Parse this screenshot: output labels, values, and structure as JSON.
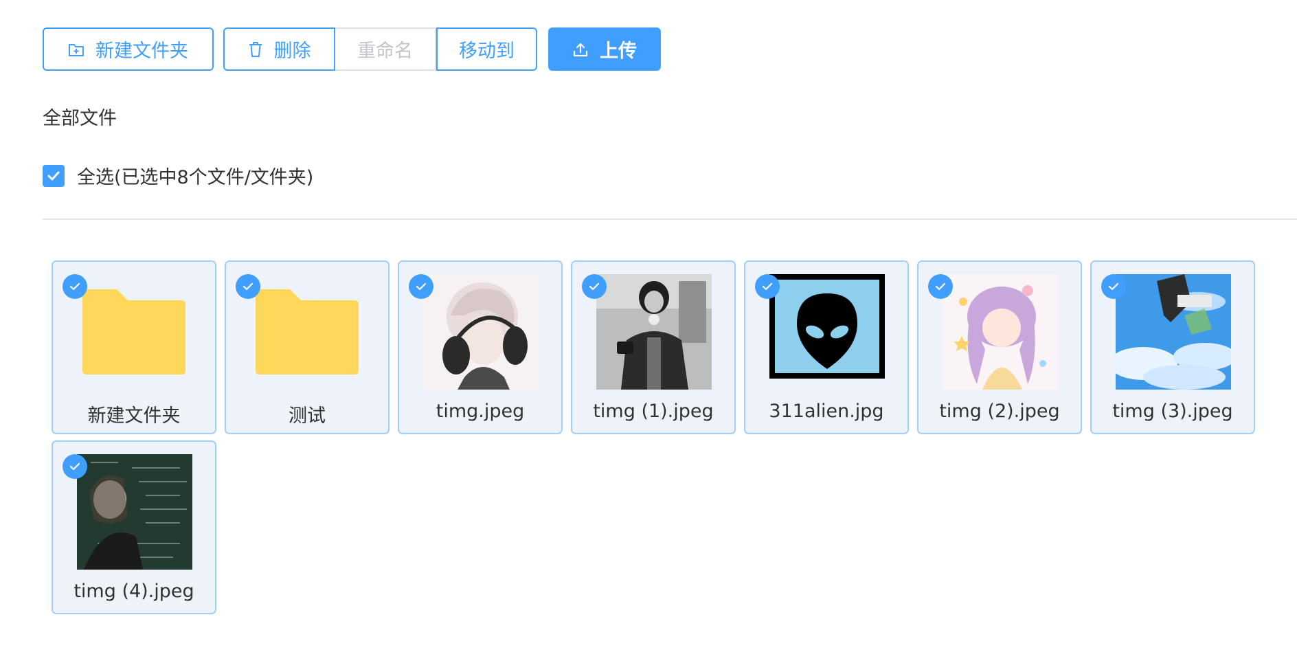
{
  "toolbar": {
    "new_folder_label": "新建文件夹",
    "delete_label": "删除",
    "rename_label": "重命名",
    "move_label": "移动到",
    "upload_label": "上传"
  },
  "breadcrumb": {
    "current": "全部文件"
  },
  "select_all": {
    "label": "全选(已选中8个文件/文件夹)",
    "checked": true
  },
  "colors": {
    "accent": "#409eff",
    "folder": "#ffd75a",
    "card_border": "#a0cfff",
    "card_bg": "#eef3fa"
  },
  "files": [
    {
      "name": "新建文件夹",
      "kind": "folder",
      "icon": "folder-icon",
      "selected": true
    },
    {
      "name": "测试",
      "kind": "folder",
      "icon": "folder-icon",
      "selected": true
    },
    {
      "name": "timg.jpeg",
      "kind": "image",
      "icon": "image-thumbnail",
      "selected": true
    },
    {
      "name": "timg (1).jpeg",
      "kind": "image",
      "icon": "image-thumbnail",
      "selected": true
    },
    {
      "name": "311alien.jpg",
      "kind": "image",
      "icon": "image-thumbnail",
      "selected": true
    },
    {
      "name": "timg (2).jpeg",
      "kind": "image",
      "icon": "image-thumbnail",
      "selected": true
    },
    {
      "name": "timg (3).jpeg",
      "kind": "image",
      "icon": "image-thumbnail",
      "selected": true
    },
    {
      "name": "timg (4).jpeg",
      "kind": "image",
      "icon": "image-thumbnail",
      "selected": true
    }
  ]
}
